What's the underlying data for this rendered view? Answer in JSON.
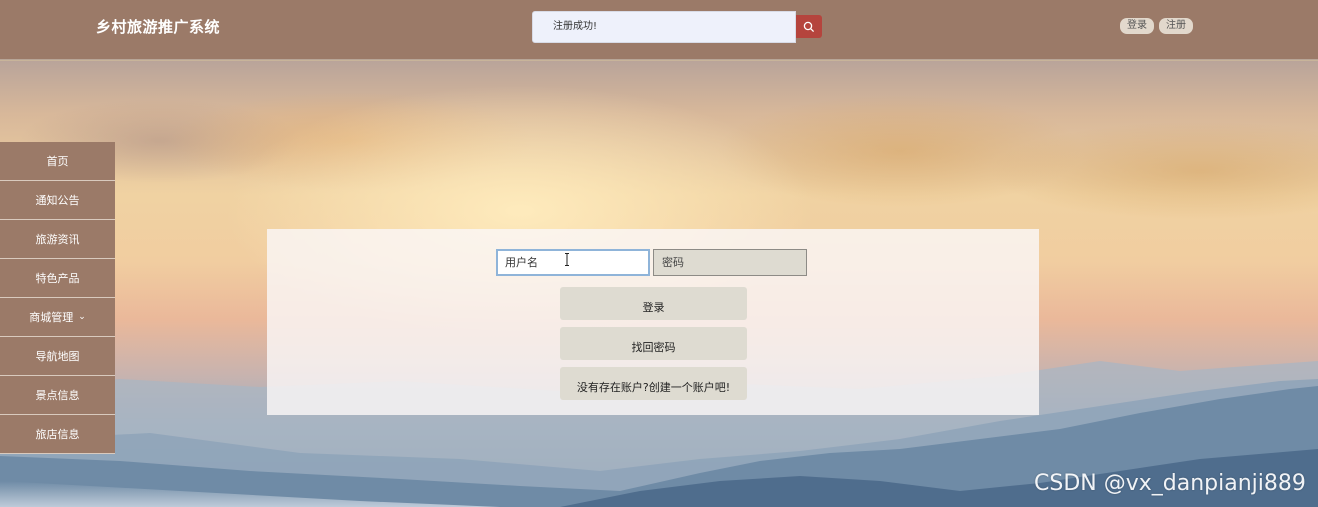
{
  "header": {
    "site_title": "乡村旅游推广系统",
    "search_value": "注册成功!",
    "login_label": "登录",
    "register_label": "注册"
  },
  "sidebar": {
    "items": [
      {
        "label": "首页"
      },
      {
        "label": "通知公告"
      },
      {
        "label": "旅游资讯"
      },
      {
        "label": "特色产品"
      },
      {
        "label": "商城管理",
        "has_dropdown": true
      },
      {
        "label": "导航地图"
      },
      {
        "label": "景点信息"
      },
      {
        "label": "旅店信息"
      }
    ]
  },
  "login_form": {
    "username_placeholder": "用户名",
    "password_placeholder": "密码",
    "login_button": "登录",
    "forgot_button": "找回密码",
    "register_link": "没有存在账户?创建一个账户吧!"
  },
  "watermark": "CSDN @vx_danpianji889",
  "colors": {
    "header_bg": "#9b7a68",
    "search_button": "#b5443d",
    "sidebar_bg": "#9b7a68",
    "button_bg": "#dedbd1"
  }
}
